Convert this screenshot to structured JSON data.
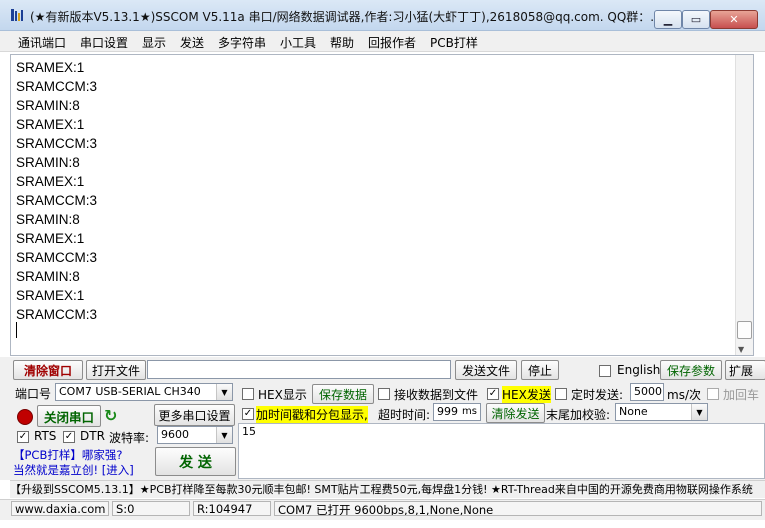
{
  "window": {
    "title": "(★有新版本V5.13.1★)SSCOM V5.11a 串口/网络数据调试器,作者:习小猛(大虾丁丁),2618058@qq.com. QQ群：...",
    "min": "▁",
    "max": "▭",
    "close": "✕"
  },
  "menu": [
    "通讯端口",
    "串口设置",
    "显示",
    "发送",
    "多字符串",
    "小工具",
    "帮助",
    "回报作者",
    "PCB打样"
  ],
  "receive": {
    "lines": [
      "SRAMEX:1",
      "SRAMCCM:3",
      "SRAMIN:8",
      "SRAMEX:1",
      "SRAMCCM:3",
      "SRAMIN:8",
      "SRAMEX:1",
      "SRAMCCM:3",
      "SRAMIN:8",
      "SRAMEX:1",
      "SRAMCCM:3",
      "SRAMIN:8",
      "SRAMEX:1",
      "SRAMCCM:3"
    ]
  },
  "toolbar": {
    "clear_window": "清除窗口",
    "open_file": "打开文件",
    "file_path": "",
    "send_file": "发送文件",
    "stop": "停止",
    "english": "English",
    "save_params": "保存参数",
    "expand": "扩展"
  },
  "port": {
    "label": "端口号",
    "value": "COM7 USB-SERIAL CH340",
    "close_port": "关闭串口",
    "more_settings": "更多串口设置",
    "rts": "RTS",
    "dtr": "DTR",
    "baud_label": "波特率:",
    "baud_value": "9600",
    "ad_line1": "【PCB打样】哪家强?",
    "ad_line2": "当然就是嘉立创! [进入]"
  },
  "options": {
    "hex_display": "HEX显示",
    "save_data": "保存数据",
    "recv_to_file": "接收数据到文件",
    "hex_send": "HEX发送",
    "timed_send": "定时发送:",
    "interval": "5000",
    "interval_unit": "ms/次",
    "add_enter": "加回车",
    "timestamp": "加时间戳和分包显示,",
    "timeout_label": "超时时间:",
    "timeout_value": "999",
    "timeout_unit": "ms",
    "clear_send": "清除发送",
    "checksum_label": "末尾加校验:",
    "checksum_value": "None"
  },
  "send": {
    "button": "发 送",
    "text": "15"
  },
  "ticker": "【升级到SSCOM5.13.1】★PCB打样降至每款30元顺丰包邮! SMT贴片工程费50元,每焊盘1分钱! ★RT-Thread来自中国的开源免费商用物联网操作系统",
  "status": {
    "website": "www.daxia.com",
    "sent": "S:0",
    "received": "R:104947",
    "port_state": "COM7 已打开  9600bps,8,1,None,None"
  },
  "colors": {
    "highlight": "#ffff00",
    "button_green": "#006400",
    "clear_red": "#a00000"
  }
}
